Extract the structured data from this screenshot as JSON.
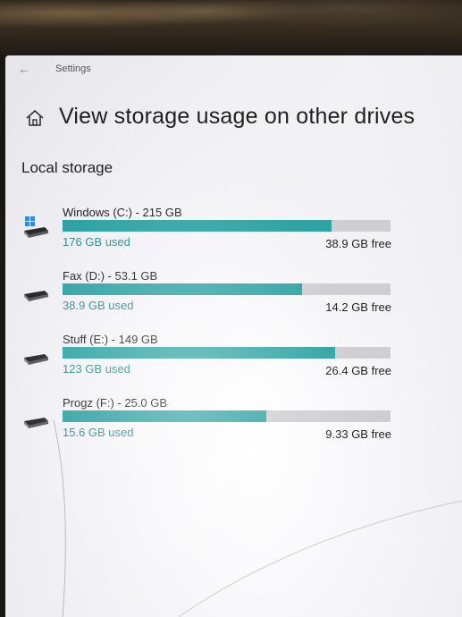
{
  "window": {
    "app_title": "Settings",
    "back_icon": "back-arrow-icon"
  },
  "header": {
    "icon": "home-icon",
    "title": "View storage usage on other drives"
  },
  "section": {
    "title": "Local storage"
  },
  "drives": [
    {
      "name": "Windows (C:) - 215 GB",
      "used": "176 GB used",
      "free": "38.9 GB free",
      "used_fraction": 0.82,
      "icon": "windows-drive-icon"
    },
    {
      "name": "Fax (D:) - 53.1 GB",
      "used": "38.9 GB used",
      "free": "14.2 GB free",
      "used_fraction": 0.73,
      "icon": "hard-drive-icon"
    },
    {
      "name": "Stuff (E:) - 149 GB",
      "used": "123 GB used",
      "free": "26.4 GB free",
      "used_fraction": 0.83,
      "icon": "hard-drive-icon"
    },
    {
      "name": "Progz (F:) - 25.0 GB",
      "used": "15.6 GB used",
      "free": "9.33 GB free",
      "used_fraction": 0.62,
      "icon": "hard-drive-icon"
    }
  ],
  "colors": {
    "accent": "#2fa3a3",
    "used_text": "#2c8f8f",
    "bar_track": "#cfcfd2"
  }
}
